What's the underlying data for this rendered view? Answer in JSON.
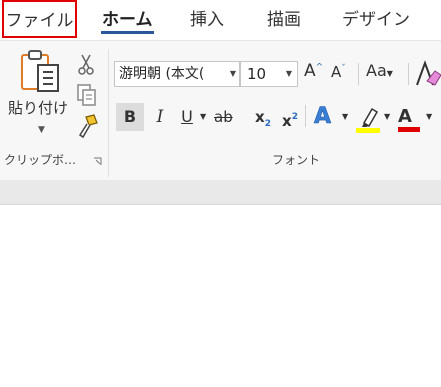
{
  "tabs": {
    "file": "ファイル",
    "home": "ホーム",
    "insert": "挿入",
    "draw": "描画",
    "design": "デザイン"
  },
  "clipboard": {
    "paste_label": "貼り付け",
    "group_label": "クリップボ…",
    "icons": [
      "paste-icon",
      "cut-icon",
      "copy-icon",
      "format-painter-icon"
    ]
  },
  "font": {
    "font_name": "游明朝 (本文(",
    "font_size": "10",
    "grow_label": "A",
    "shrink_label": "A",
    "case_label": "Aa",
    "bold_label": "B",
    "italic_label": "I",
    "underline_label": "U",
    "strike_label": "ab",
    "subscript_label": "x",
    "subscript_mark": "2",
    "superscript_label": "x",
    "superscript_mark": "2",
    "effects_label": "A",
    "font_color_label": "A",
    "group_label": "フォント"
  },
  "colors": {
    "file_highlight": "#e00000",
    "home_underline": "#2b579a",
    "highlight_color": "#ffff00",
    "font_color": "#e00000"
  }
}
